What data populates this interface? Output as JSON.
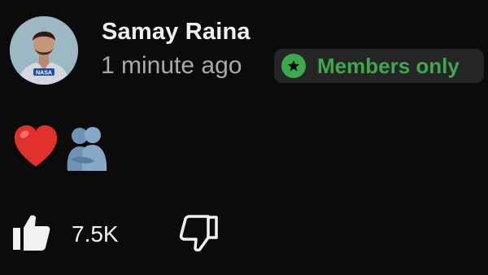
{
  "post": {
    "author_name": "Samay Raina",
    "timestamp": "1 minute ago",
    "badge": {
      "label": "Members only",
      "icon": "star-icon",
      "color": "#3ea84e"
    },
    "avatar": {
      "icon": "avatar-image",
      "shirt_text": "NASA"
    },
    "emojis": [
      "red-heart",
      "people-hugging"
    ]
  },
  "actions": {
    "like_icon": "thumbs-up-icon",
    "like_count": "7.5K",
    "dislike_icon": "thumbs-down-icon"
  },
  "colors": {
    "background": "#0b0b0b",
    "primary_text": "#f1f1f1",
    "secondary_text": "#aaaaaa",
    "badge_background": "#252525",
    "members_green": "#3ea84e"
  }
}
